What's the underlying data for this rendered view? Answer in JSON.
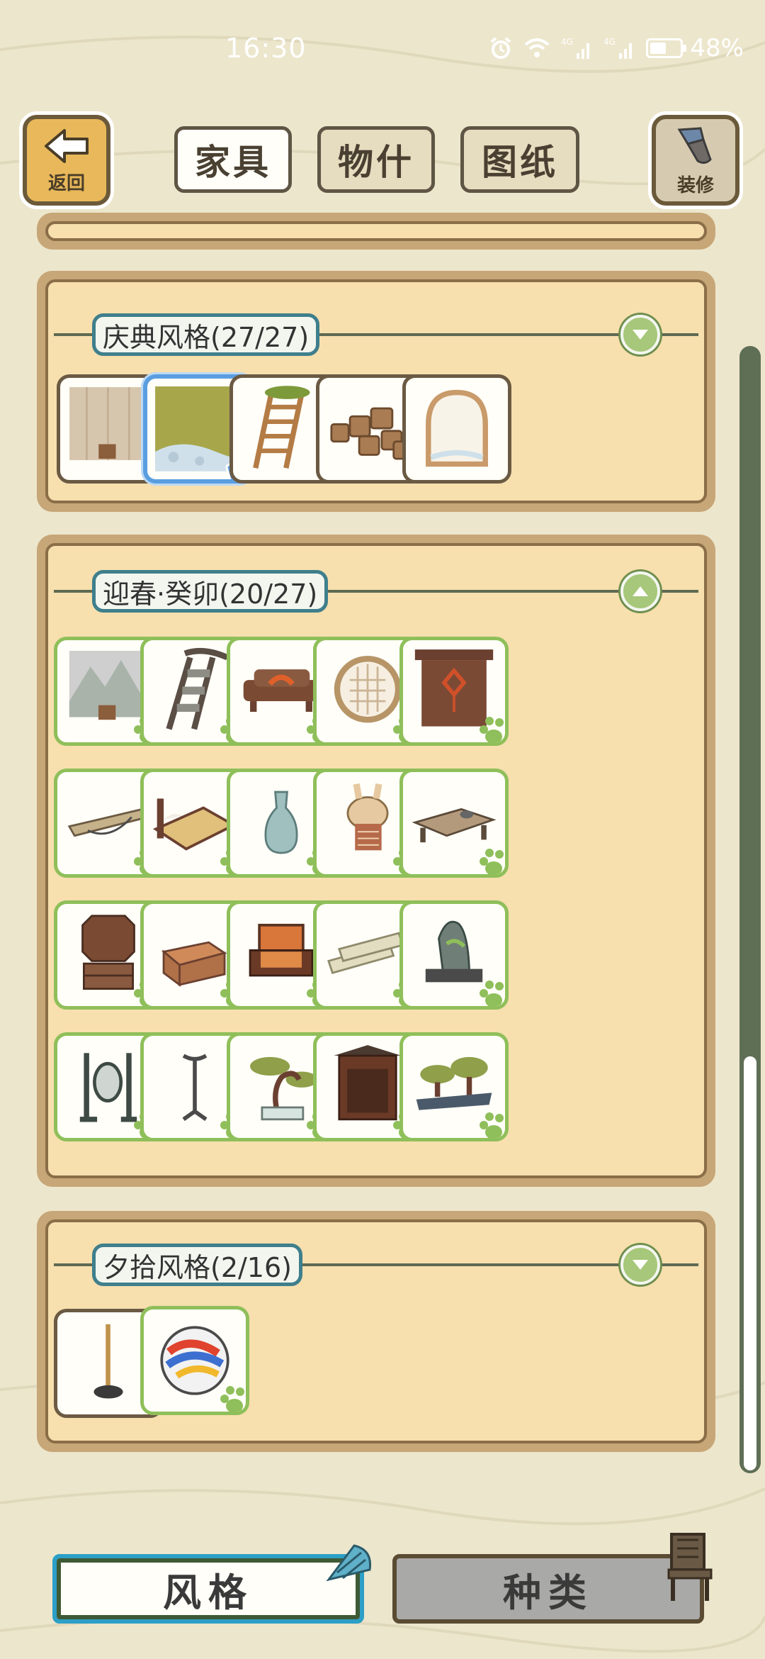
{
  "status_bar": {
    "time": "16:30",
    "battery": "48%"
  },
  "header": {
    "back_label": "返回",
    "decorate_label": "装修",
    "tabs": [
      {
        "label": "家具"
      },
      {
        "label": "物什"
      },
      {
        "label": "图纸"
      }
    ]
  },
  "groups": [
    {
      "title": "庆典风格(27/27)",
      "expanded": false
    },
    {
      "title": "迎春·癸卯(20/27)",
      "expanded": true
    },
    {
      "title": "夕拾风格(2/16)",
      "expanded": false
    }
  ],
  "bottom": {
    "style_label": "风格",
    "category_label": "种类"
  },
  "colors": {
    "panel": "#f7dfae",
    "owned_border": "#8fbf5a",
    "selected_border": "#5a9ee0",
    "tag_border": "#3f7f8c"
  }
}
